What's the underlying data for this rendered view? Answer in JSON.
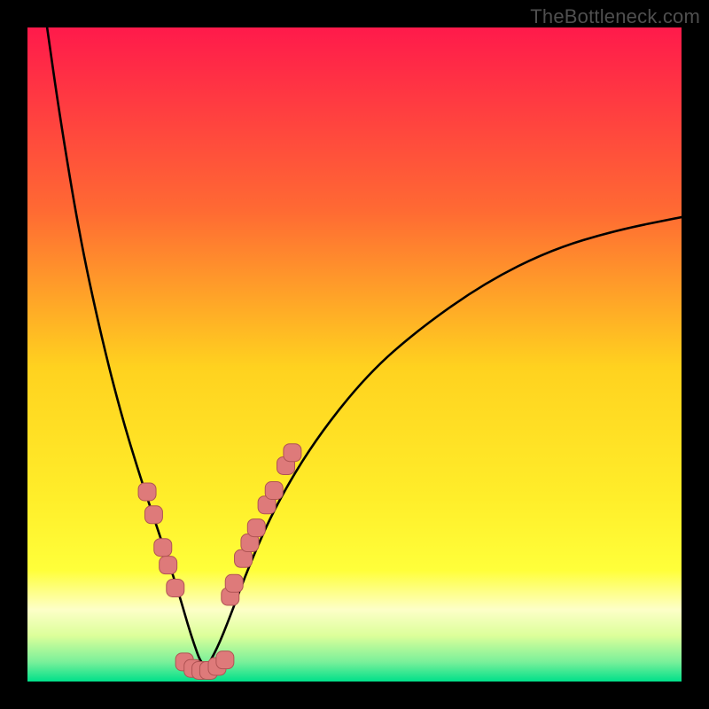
{
  "watermark": "TheBottleneck.com",
  "colors": {
    "frame": "#000000",
    "grad_top": "#ff1a4b",
    "grad_mid1": "#ff7a2f",
    "grad_mid2": "#ffd21f",
    "grad_mid3": "#ffff3a",
    "grad_low1": "#f7ffb0",
    "grad_low2": "#d8ff9e",
    "grad_bottom": "#00e08a",
    "curve": "#000000",
    "dot_fill": "#de7a7a",
    "dot_stroke": "#b05454"
  },
  "chart_data": {
    "type": "line",
    "title": "",
    "xlabel": "",
    "ylabel": "",
    "xlim": [
      0,
      100
    ],
    "ylim": [
      0,
      100
    ],
    "x_min_at": 27,
    "curve_comment": "V-shaped bottleneck curve, minimum ≈ x=27, left branch steep to top-left near x≈3, right branch rising with decreasing slope to ≈y=71 at x=100",
    "series": [
      {
        "name": "bottleneck-curve",
        "x": [
          3,
          5,
          8,
          11,
          14,
          17,
          20,
          23,
          25,
          27,
          29,
          31,
          34,
          38,
          44,
          52,
          60,
          70,
          80,
          90,
          100
        ],
        "y": [
          100,
          86,
          68,
          54,
          42,
          32,
          23,
          14,
          7,
          1.5,
          5,
          10,
          18,
          27,
          37,
          47,
          54,
          61,
          66,
          69,
          71
        ]
      }
    ],
    "dots_comment": "Pink dots clustered on both branches near the bottom of the V and along the trough",
    "dots": [
      {
        "x": 18.3,
        "y": 29.0
      },
      {
        "x": 19.3,
        "y": 25.5
      },
      {
        "x": 20.7,
        "y": 20.5
      },
      {
        "x": 21.5,
        "y": 17.8
      },
      {
        "x": 22.6,
        "y": 14.3
      },
      {
        "x": 24.0,
        "y": 3.0
      },
      {
        "x": 25.3,
        "y": 2.0
      },
      {
        "x": 26.5,
        "y": 1.7
      },
      {
        "x": 27.7,
        "y": 1.7
      },
      {
        "x": 29.0,
        "y": 2.3
      },
      {
        "x": 30.2,
        "y": 3.3
      },
      {
        "x": 31.0,
        "y": 13.0
      },
      {
        "x": 31.6,
        "y": 15.0
      },
      {
        "x": 33.0,
        "y": 18.8
      },
      {
        "x": 34.0,
        "y": 21.2
      },
      {
        "x": 35.0,
        "y": 23.5
      },
      {
        "x": 36.6,
        "y": 27.0
      },
      {
        "x": 37.7,
        "y": 29.2
      },
      {
        "x": 39.5,
        "y": 33.0
      },
      {
        "x": 40.5,
        "y": 35.0
      }
    ]
  }
}
